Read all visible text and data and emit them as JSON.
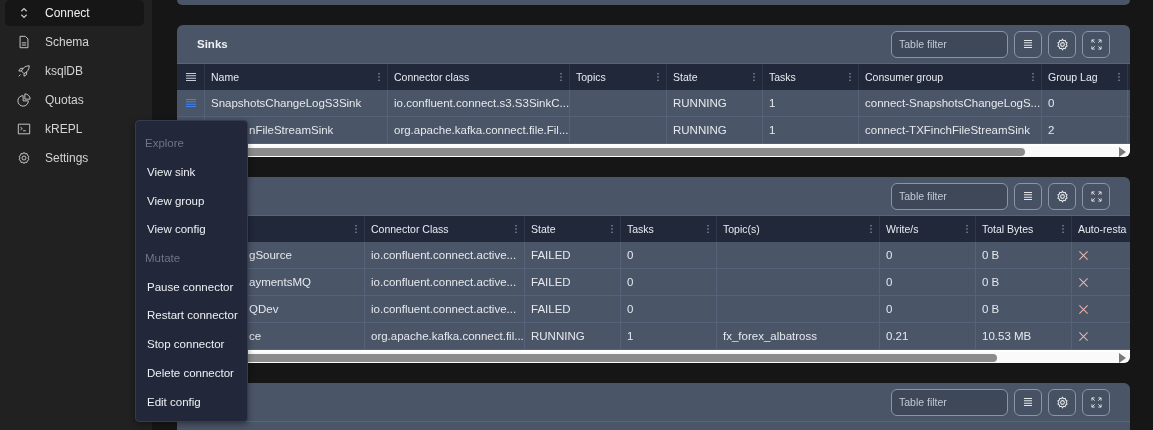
{
  "sidebar": {
    "items": [
      {
        "label": "Connect",
        "selected": true
      },
      {
        "label": "Schema",
        "selected": false
      },
      {
        "label": "ksqlDB",
        "selected": false
      },
      {
        "label": "Quotas",
        "selected": false
      },
      {
        "label": "kREPL",
        "selected": false
      },
      {
        "label": "Settings",
        "selected": false
      }
    ]
  },
  "panels": [
    {
      "kind": "stub"
    },
    {
      "kind": "table",
      "title": "Sinks",
      "filter": {
        "placeholder": "Table filter"
      },
      "table": {
        "handle": true,
        "columns": [
          {
            "kind": "text",
            "label": "Name",
            "menu": true
          },
          {
            "kind": "text",
            "label": "Connector class",
            "menu": true
          },
          {
            "kind": "text",
            "label": "Topics",
            "menu": true
          },
          {
            "kind": "text",
            "label": "State",
            "menu": true
          },
          {
            "kind": "text",
            "label": "Tasks",
            "menu": true
          },
          {
            "kind": "text",
            "label": "Consumer group",
            "menu": true
          },
          {
            "kind": "text",
            "label": "Group Lag",
            "menu": true
          }
        ],
        "rows": [
          {
            "selected": true,
            "clipped": false,
            "cells": [
              "SnapshotsChangeLogS3Sink",
              "io.confluent.connect.s3.S3SinkC...",
              null,
              "RUNNING",
              "1",
              "connect-SnapshotsChangeLogS...",
              "0"
            ]
          },
          {
            "clipped": true,
            "cells": [
              "nFileStreamSink",
              "org.apache.kafka.connect.file.Fil...",
              null,
              "RUNNING",
              "1",
              "connect-TXFinchFileStreamSink",
              "2"
            ]
          }
        ]
      }
    },
    {
      "kind": "table",
      "filter": {
        "placeholder": "Table filter"
      },
      "table": {
        "handle": false,
        "columns": [
          {
            "kind": "text",
            "menu": true
          },
          {
            "kind": "text",
            "label": "Connector Class",
            "menu": true
          },
          {
            "kind": "text",
            "label": "State",
            "menu": true
          },
          {
            "kind": "text",
            "label": "Tasks",
            "menu": true
          },
          {
            "kind": "text",
            "label": "Topic(s)",
            "menu": true
          },
          {
            "kind": "text",
            "label": "Write/s",
            "menu": true
          },
          {
            "kind": "text",
            "label": "Total Bytes",
            "menu": true
          },
          {
            "kind": "text",
            "label": "Auto-resta",
            "menu": false
          }
        ],
        "rows": [
          {
            "clipped": true,
            "auto_restart": false,
            "cells": [
              "gSource",
              "io.confluent.connect.active...",
              "FAILED",
              "0",
              null,
              "0",
              "0 B"
            ]
          },
          {
            "clipped": true,
            "auto_restart": false,
            "cells": [
              "aymentsMQ",
              "io.confluent.connect.active...",
              "FAILED",
              "0",
              null,
              "0",
              "0 B"
            ]
          },
          {
            "clipped": true,
            "auto_restart": false,
            "cells": [
              "QDev",
              "io.confluent.connect.active...",
              "FAILED",
              "0",
              null,
              "0",
              "0 B"
            ]
          },
          {
            "clipped": true,
            "auto_restart": false,
            "cells": [
              "ce",
              "org.apache.kafka.connect.fil...",
              "RUNNING",
              "1",
              "fx_forex_albatross",
              "0.21",
              "10.53 MB"
            ]
          }
        ]
      }
    },
    {
      "kind": "table",
      "filter": {
        "placeholder": "Table filter"
      }
    }
  ],
  "context_menu": {
    "items": [
      {
        "kind": "header",
        "label": "Explore"
      },
      {
        "kind": "action",
        "label": "View sink"
      },
      {
        "kind": "action",
        "label": "View group"
      },
      {
        "kind": "action",
        "label": "View config"
      },
      {
        "kind": "header",
        "label": "Mutate"
      },
      {
        "kind": "action",
        "label": "Pause connector"
      },
      {
        "kind": "action",
        "label": "Restart connector"
      },
      {
        "kind": "action",
        "label": "Stop connector"
      },
      {
        "kind": "action",
        "label": "Delete connector"
      },
      {
        "kind": "action",
        "label": "Edit config"
      }
    ]
  }
}
